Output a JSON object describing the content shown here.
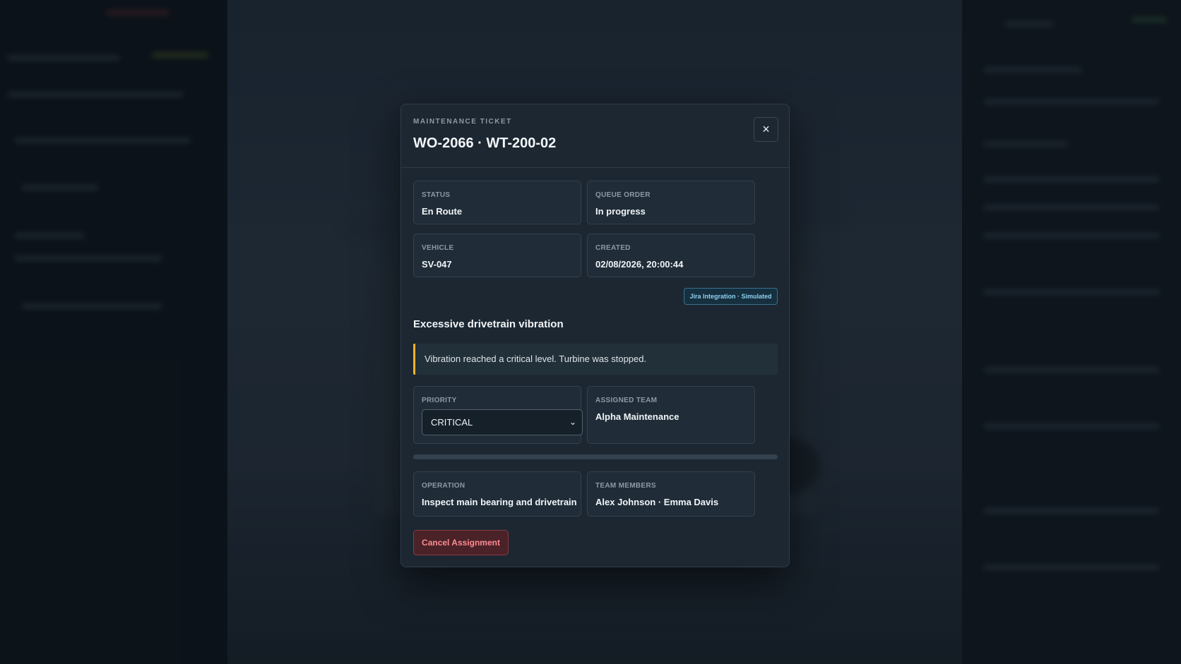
{
  "modal": {
    "eyebrow": "MAINTENANCE TICKET",
    "title": "WO-2066 · WT-200-02",
    "close_icon": "×",
    "status": {
      "label": "STATUS",
      "value": "En Route"
    },
    "queue_order": {
      "label": "QUEUE ORDER",
      "value": "In progress"
    },
    "vehicle": {
      "label": "VEHICLE",
      "value": "SV-047"
    },
    "created": {
      "label": "CREATED",
      "value": "02/08/2026, 20:00:44"
    },
    "integration_badge": "Jira Integration · Simulated",
    "issue_title": "Excessive drivetrain vibration",
    "issue_note": "Vibration reached a critical level. Turbine was stopped.",
    "priority": {
      "label": "PRIORITY",
      "selected": "CRITICAL"
    },
    "assigned_team": {
      "label": "ASSIGNED TEAM",
      "value": "Alpha Maintenance"
    },
    "progress": {
      "fraction": 0
    },
    "operation": {
      "label": "OPERATION",
      "value": "Inspect main bearing and drivetrain"
    },
    "team_members": {
      "label": "TEAM MEMBERS",
      "value": "Alex Johnson · Emma Davis"
    },
    "cancel_label": "Cancel Assignment"
  },
  "colors": {
    "accent_warning": "#f0b429",
    "danger": "#ff8b92",
    "badge": "#8fd0ee"
  },
  "icons": {
    "close": "close-icon",
    "chevron": "chevron-down-icon"
  }
}
